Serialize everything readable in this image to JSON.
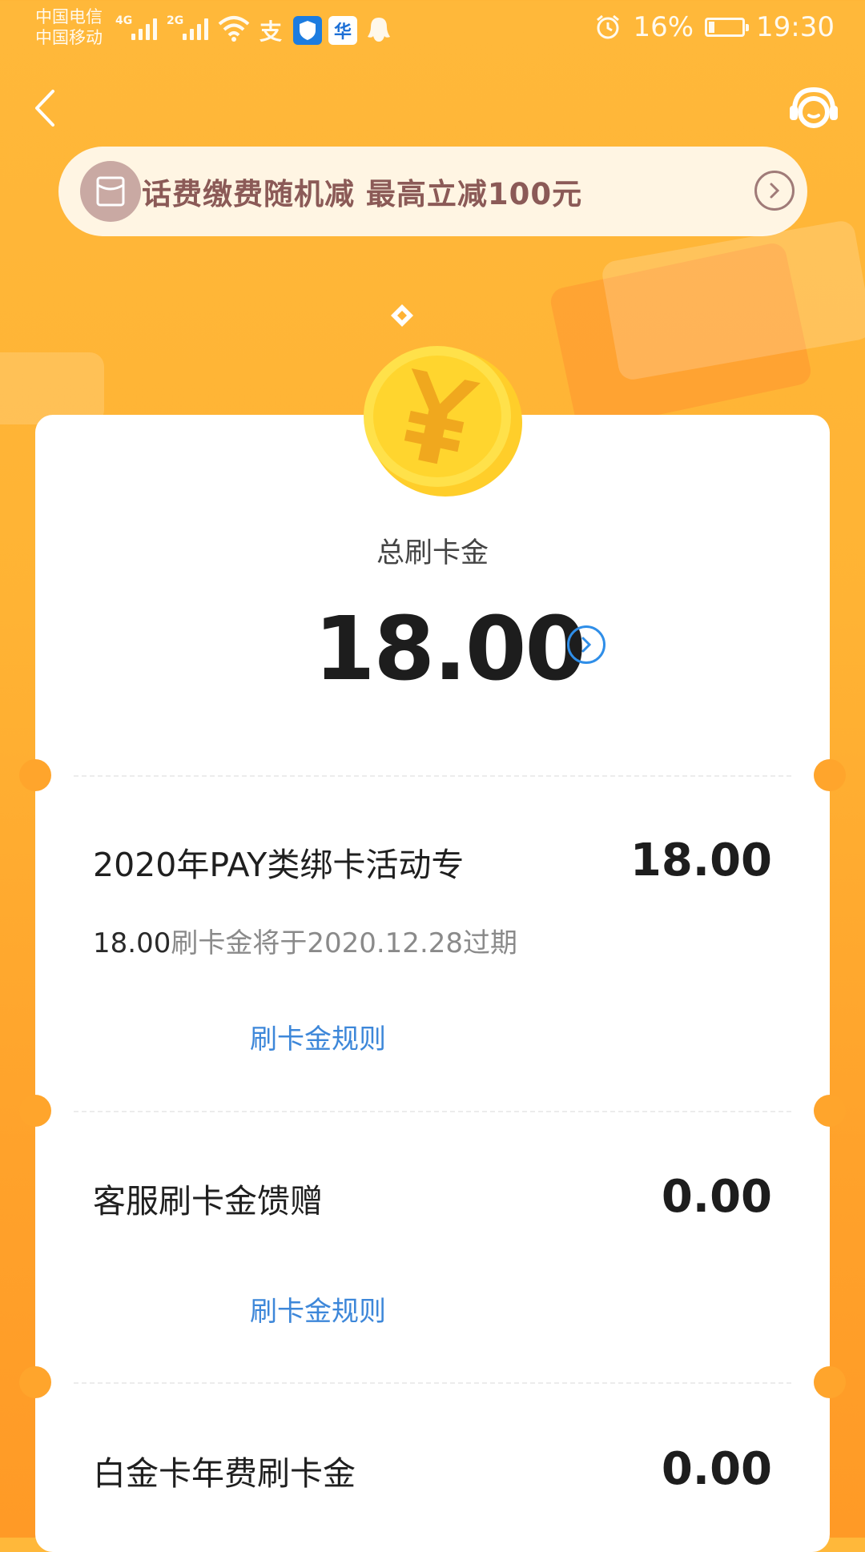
{
  "status_bar": {
    "carrier_1": "中国电信",
    "carrier_2": "中国移动",
    "net_1": "4G",
    "net_2": "2G",
    "battery_percent": "16%",
    "battery_level": 0.16,
    "time": "19:30",
    "app_icon_ali": "支",
    "app_icon_shop": "华"
  },
  "header": {
    "back_icon": "chevron-left-icon",
    "service_icon": "customer-service-icon"
  },
  "banner": {
    "text": "话费缴费随机减 最高立减100元",
    "icon": "red-envelope-icon"
  },
  "summary": {
    "label": "总刷卡金",
    "amount": "18.00"
  },
  "items": [
    {
      "title": "2020年PAY类绑卡活动专",
      "amount": "18.00",
      "expiry_amount": "18.00",
      "expiry_text": "刷卡金将于2020.12.28过期",
      "rule_link": "刷卡金规则"
    },
    {
      "title": "客服刷卡金馈赠",
      "amount": "0.00",
      "rule_link": "刷卡金规则"
    },
    {
      "title": "白金卡年费刷卡金",
      "amount": "0.00"
    }
  ],
  "colors": {
    "background": "#ffb334",
    "link": "#3d87d9",
    "banner_text": "#8b5a57"
  }
}
